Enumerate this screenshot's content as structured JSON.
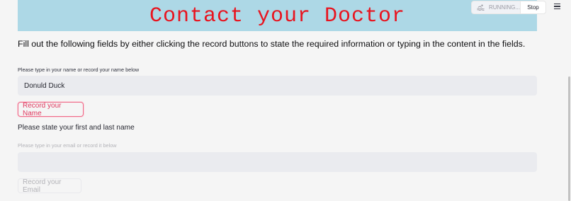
{
  "header": {
    "title": "Contact your Doctor"
  },
  "toolbar": {
    "status_label": "RUNNING...",
    "status_icon": "swimmer-icon",
    "stop_label": "Stop",
    "menu_icon": "hamburger-menu-icon"
  },
  "intro": "Fill out the following fields by either clicking the record buttons to state the required information or typing in the content in the fields.",
  "name_section": {
    "label": "Please type in your name or record your name below",
    "value": "Donuld Duck",
    "record_label": "Record your Name",
    "instruction": "Please state your first and last name"
  },
  "email_section": {
    "label": "Please type in your email or record it below",
    "value": "",
    "record_label": "Record your Email"
  },
  "colors": {
    "banner": "#add8e6",
    "title": "#e8141f",
    "accent": "#e0395f",
    "background": "#f5f5f5"
  }
}
